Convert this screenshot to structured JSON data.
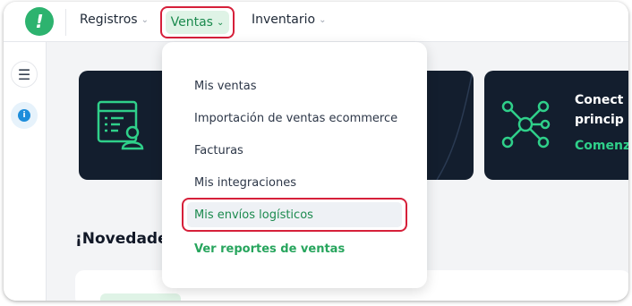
{
  "app": {
    "logo_glyph": "!",
    "brand_color": "#2db36f"
  },
  "topnav": {
    "items": [
      {
        "label": "Registros",
        "icon": "chevron-down-icon"
      },
      {
        "label": "Ventas",
        "icon": "chevron-down-icon",
        "active": true
      },
      {
        "label": "Inventario",
        "icon": "chevron-down-icon"
      }
    ]
  },
  "sidebar": {
    "icons": [
      "menu-icon",
      "info-icon"
    ]
  },
  "cards": [
    {
      "icon": "invoice-user-icon",
      "title_lines": [
        "",
        ""
      ],
      "cta": ""
    },
    {
      "icon": "network-hub-icon",
      "title_lines": [
        "Conect",
        "princip"
      ],
      "cta": "Comenz"
    }
  ],
  "section_title": "¡Novedade",
  "dropdown": {
    "items": [
      {
        "label": "Mis ventas"
      },
      {
        "label": "Importación de ventas ecommerce"
      },
      {
        "label": "Facturas"
      },
      {
        "label": "Mis integraciones"
      },
      {
        "label": "Mis envíos logísticos",
        "highlighted": true
      },
      {
        "label": "Ver reportes de ventas",
        "style": "link"
      }
    ]
  },
  "colors": {
    "accent_green": "#2db36f",
    "highlight_red": "#d6203a",
    "card_dark": "#131e2e",
    "cta_green": "#2fd08a"
  }
}
